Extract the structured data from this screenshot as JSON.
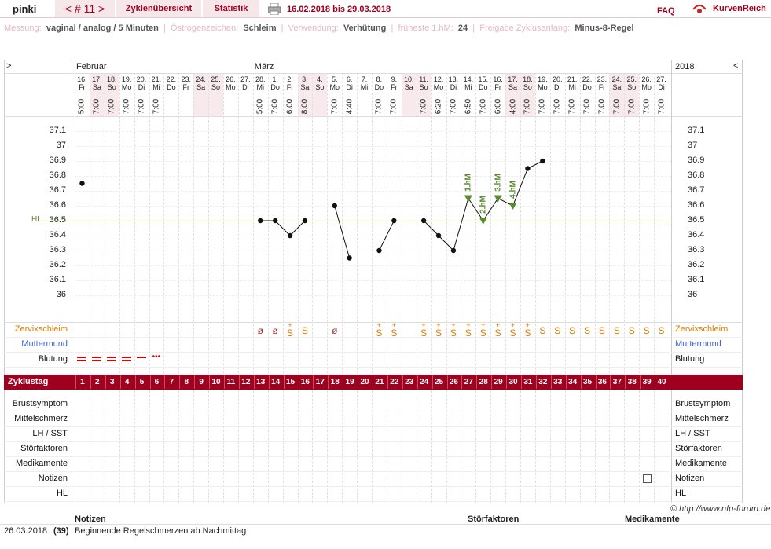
{
  "header": {
    "user": "pinki",
    "cycle_nav": "< # 11 >",
    "tab_overview": "Zyklenübersicht",
    "tab_stats": "Statistik",
    "date_range": "16.02.2018 bis 29.03.2018",
    "faq": "FAQ",
    "brand": "KurvenReich"
  },
  "settings": [
    {
      "label": "Messung:",
      "value": "vaginal / analog / 5 Minuten"
    },
    {
      "label": "Östrogenzeichen:",
      "value": "Schleim"
    },
    {
      "label": "Verwendung:",
      "value": "Verhütung"
    },
    {
      "label": "früheste 1.hM:",
      "value": "24"
    },
    {
      "label": "Freigabe Zyklusanfang:",
      "value": "Minus-8-Regel"
    }
  ],
  "nav": {
    "left_arrow": ">",
    "right_arrow": "<",
    "year": "2018"
  },
  "months": [
    {
      "label": "Februar",
      "col": 0
    },
    {
      "label": "März",
      "col": 12
    }
  ],
  "days": [
    {
      "d": "16.",
      "w": "Fr",
      "t": "5:00"
    },
    {
      "d": "17.",
      "w": "Sa",
      "t": "7:00"
    },
    {
      "d": "18.",
      "w": "So",
      "t": "7:00"
    },
    {
      "d": "19.",
      "w": "Mo",
      "t": "7:00"
    },
    {
      "d": "20.",
      "w": "Di",
      "t": "7:00"
    },
    {
      "d": "21.",
      "w": "Mi",
      "t": "7:00"
    },
    {
      "d": "22.",
      "w": "Do",
      "t": ""
    },
    {
      "d": "23.",
      "w": "Fr",
      "t": ""
    },
    {
      "d": "24.",
      "w": "Sa",
      "t": ""
    },
    {
      "d": "25.",
      "w": "So",
      "t": ""
    },
    {
      "d": "26.",
      "w": "Mo",
      "t": ""
    },
    {
      "d": "27.",
      "w": "Di",
      "t": ""
    },
    {
      "d": "28.",
      "w": "Mi",
      "t": "5:00"
    },
    {
      "d": "1.",
      "w": "Do",
      "t": "7:00"
    },
    {
      "d": "2.",
      "w": "Fr",
      "t": "6:00"
    },
    {
      "d": "3.",
      "w": "Sa",
      "t": "8:00"
    },
    {
      "d": "4.",
      "w": "So",
      "t": ""
    },
    {
      "d": "5.",
      "w": "Mo",
      "t": "7:00"
    },
    {
      "d": "6.",
      "w": "Di",
      "t": "4:40"
    },
    {
      "d": "7.",
      "w": "Mi",
      "t": ""
    },
    {
      "d": "8.",
      "w": "Do",
      "t": "7:00"
    },
    {
      "d": "9.",
      "w": "Fr",
      "t": "7:00"
    },
    {
      "d": "10.",
      "w": "Sa",
      "t": ""
    },
    {
      "d": "11.",
      "w": "So",
      "t": "7:00"
    },
    {
      "d": "12.",
      "w": "Mo",
      "t": "6:20"
    },
    {
      "d": "13.",
      "w": "Di",
      "t": "7:00"
    },
    {
      "d": "14.",
      "w": "Mi",
      "t": "6:50"
    },
    {
      "d": "15.",
      "w": "Do",
      "t": "7:00"
    },
    {
      "d": "16.",
      "w": "Fr",
      "t": "6:00"
    },
    {
      "d": "17.",
      "w": "Sa",
      "t": "4:00"
    },
    {
      "d": "18.",
      "w": "So",
      "t": "7:00"
    },
    {
      "d": "19.",
      "w": "Mo",
      "t": "7:00"
    },
    {
      "d": "20.",
      "w": "Di",
      "t": "7:00"
    },
    {
      "d": "21.",
      "w": "Mi",
      "t": "7:00"
    },
    {
      "d": "22.",
      "w": "Do",
      "t": "7:00"
    },
    {
      "d": "23.",
      "w": "Fr",
      "t": "7:00"
    },
    {
      "d": "24.",
      "w": "Sa",
      "t": "7:00"
    },
    {
      "d": "25.",
      "w": "So",
      "t": "7:00"
    },
    {
      "d": "26.",
      "w": "Mo",
      "t": "7:00"
    },
    {
      "d": "27.",
      "w": "Di",
      "t": "7:00"
    }
  ],
  "y_ticks": [
    "37.1",
    "37",
    "36.9",
    "36.8",
    "36.7",
    "36.6",
    "36.5",
    "36.4",
    "36.3",
    "36.2",
    "36.1",
    "36"
  ],
  "hl": {
    "label": "HL",
    "value": 36.5
  },
  "chart_data": {
    "type": "line",
    "ylim": [
      36.0,
      37.1
    ],
    "series": [
      {
        "points": [
          {
            "day": 1,
            "temp": 36.75
          },
          {
            "day": 13,
            "temp": 36.5
          },
          {
            "day": 14,
            "temp": 36.5
          },
          {
            "day": 15,
            "temp": 36.4
          },
          {
            "day": 16,
            "temp": 36.5
          },
          {
            "day": 18,
            "temp": 36.6
          },
          {
            "day": 19,
            "temp": 36.25
          },
          {
            "day": 21,
            "temp": 36.3
          },
          {
            "day": 22,
            "temp": 36.5
          },
          {
            "day": 24,
            "temp": 36.5
          },
          {
            "day": 25,
            "temp": 36.4
          },
          {
            "day": 26,
            "temp": 36.3
          },
          {
            "day": 27,
            "temp": 36.65
          },
          {
            "day": 28,
            "temp": 36.5
          },
          {
            "day": 29,
            "temp": 36.65
          },
          {
            "day": 30,
            "temp": 36.6
          },
          {
            "day": 31,
            "temp": 36.85
          },
          {
            "day": 32,
            "temp": 36.9
          }
        ],
        "segments": [
          [
            1
          ],
          [
            13,
            14,
            15,
            16
          ],
          [
            18,
            19
          ],
          [
            21,
            22
          ],
          [
            24,
            25,
            26,
            27,
            28,
            29,
            30,
            31,
            32
          ]
        ]
      }
    ],
    "markers": [
      {
        "day": 27,
        "label": "1.hM"
      },
      {
        "day": 28,
        "label": "2.hM"
      },
      {
        "day": 29,
        "label": "3.hM"
      },
      {
        "day": 30,
        "label": "4.hM"
      }
    ]
  },
  "rows": {
    "cervix": "Zervixschleim",
    "mumu": "Muttermund",
    "bleeding": "Blutung",
    "cycle_day": "Zyklustag",
    "breast": "Brustsymptom",
    "mittel": "Mittelschmerz",
    "lh": "LH / SST",
    "stoer": "Störfaktoren",
    "medi": "Medikamente",
    "notes": "Notizen",
    "hl": "HL"
  },
  "cervix_values": [
    "",
    "",
    "",
    "",
    "",
    "",
    "",
    "",
    "",
    "",
    "",
    "",
    "ø",
    "ø",
    "S+",
    "S",
    "",
    "ø",
    "",
    "",
    "S+",
    "S+",
    "",
    "S+",
    "S+",
    "S+",
    "S+",
    "S+",
    "S+",
    "S+",
    "S+",
    "S",
    "S",
    "S",
    "S",
    "S",
    "S",
    "S",
    "S",
    "S"
  ],
  "bleeding_values": [
    "heavy",
    "heavy",
    "heavy",
    "heavy",
    "medium",
    "light"
  ],
  "cycle_days": [
    "1",
    "2",
    "3",
    "4",
    "5",
    "6",
    "7",
    "8",
    "9",
    "10",
    "11",
    "12",
    "13",
    "14",
    "15",
    "16",
    "17",
    "18",
    "19",
    "20",
    "21",
    "22",
    "23",
    "24",
    "25",
    "26",
    "27",
    "28",
    "29",
    "30",
    "31",
    "32",
    "33",
    "34",
    "35",
    "36",
    "37",
    "38",
    "39",
    "40"
  ],
  "note_icon_day": 39,
  "copyright": "© http://www.nfp-forum.de",
  "footer": {
    "h_notes": "Notizen",
    "h_stoer": "Störfaktoren",
    "h_medi": "Medikamente",
    "date": "26.03.2018",
    "day": "(39)",
    "note": "Beginnende Regelschmerzen ab Nachmittag"
  },
  "colors": {
    "accent": "#a00020",
    "tab_bg": "#f6e7ea",
    "weekend": "#f7e9ec",
    "hl_line": "#6a8a2a",
    "marker": "#5a8a30",
    "cervix": "#e07b00",
    "mumu": "#4466cc",
    "bleed": "#dd0000"
  }
}
